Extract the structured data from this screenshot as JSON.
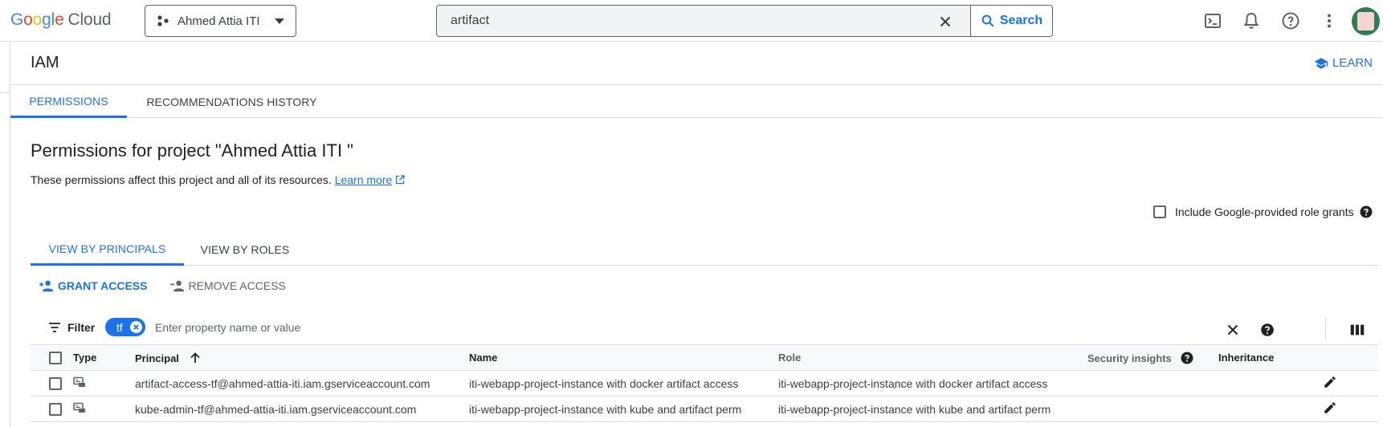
{
  "header": {
    "logo_text": "Google Cloud",
    "project_name": "Ahmed Attia ITI",
    "search_value": "artifact",
    "search_button": "Search"
  },
  "page": {
    "title": "IAM",
    "learn_label": "LEARN"
  },
  "main_tabs": [
    {
      "label": "PERMISSIONS",
      "active": true
    },
    {
      "label": "RECOMMENDATIONS HISTORY",
      "active": false
    }
  ],
  "content": {
    "heading": "Permissions for project \"Ahmed Attia ITI \"",
    "description": "These permissions affect this project and all of its resources.",
    "learn_more": "Learn more",
    "include_grants_label": "Include Google-provided role grants"
  },
  "sub_tabs": [
    {
      "label": "VIEW BY PRINCIPALS",
      "active": true
    },
    {
      "label": "VIEW BY ROLES",
      "active": false
    }
  ],
  "actions": {
    "grant_access": "GRANT ACCESS",
    "remove_access": "REMOVE ACCESS"
  },
  "filter": {
    "label": "Filter",
    "chip_text": "tf",
    "placeholder": "Enter property name or value"
  },
  "table": {
    "columns": {
      "type": "Type",
      "principal": "Principal",
      "name": "Name",
      "role": "Role",
      "security_insights": "Security insights",
      "inheritance": "Inheritance"
    },
    "rows": [
      {
        "principal": "artifact-access-tf@ahmed-attia-iti.iam.gserviceaccount.com",
        "name": "iti-webapp-project-instance with docker artifact access",
        "role": "iti-webapp-project-instance with docker artifact access"
      },
      {
        "principal": "kube-admin-tf@ahmed-attia-iti.iam.gserviceaccount.com",
        "name": "iti-webapp-project-instance with kube and artifact perm",
        "role": "iti-webapp-project-instance with kube and artifact perm"
      }
    ]
  },
  "colors": {
    "accent": "#1a73e8",
    "border": "#dadce0",
    "text": "#202124",
    "muted": "#5f6368"
  }
}
